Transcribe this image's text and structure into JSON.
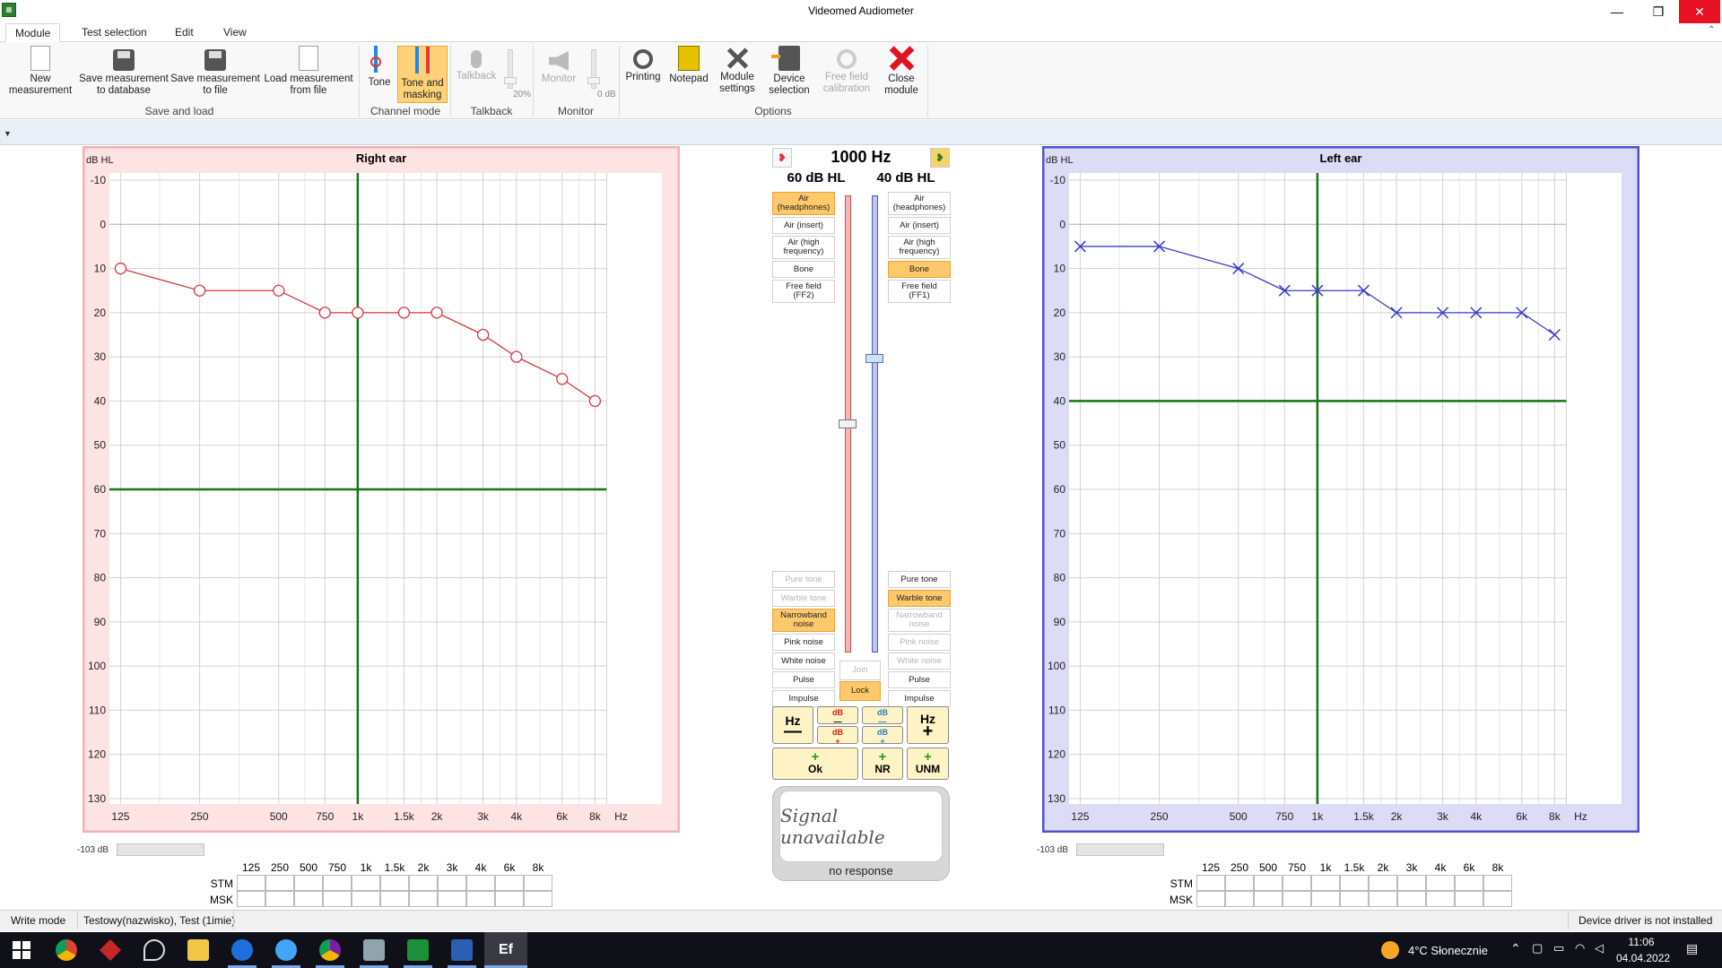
{
  "window": {
    "title": "Videomed Audiometer"
  },
  "ribbon": {
    "tabs": [
      "Module",
      "Test selection",
      "Edit",
      "View"
    ],
    "active_tab": "Module",
    "buttons": {
      "new_measurement": "New\nmeasurement",
      "save_db": "Save measurement\nto database",
      "save_file": "Save measurement\nto file",
      "load_file": "Load measurement\nfrom file",
      "tone": "Tone",
      "tone_masking": "Tone and\nmasking",
      "talkback": "Talkback",
      "monitor": "Monitor",
      "printing": "Printing",
      "notepad": "Notepad",
      "module_settings": "Module\nsettings",
      "device_selection": "Device\nselection",
      "free_field": "Free field\ncalibration",
      "close_module": "Close\nmodule"
    },
    "talkback_level": "20%",
    "monitor_level": "0 dB",
    "groups": {
      "save_load": "Save and load",
      "channel_mode": "Channel mode",
      "talkback": "Talkback",
      "monitor": "Monitor",
      "options": "Options"
    }
  },
  "charts": {
    "y_unit": "dB HL",
    "x_unit": "Hz",
    "y_ticks": [
      "-10",
      "0",
      "10",
      "20",
      "30",
      "40",
      "50",
      "60",
      "70",
      "80",
      "90",
      "100",
      "110",
      "120",
      "130"
    ],
    "x_ticks": [
      "125",
      "250",
      "500",
      "750",
      "1k",
      "1.5k",
      "2k",
      "3k",
      "4k",
      "6k",
      "8k"
    ]
  },
  "chart_data": [
    {
      "type": "line",
      "title": "Right ear",
      "xlabel": "Hz",
      "ylabel": "dB HL",
      "x": [
        "125",
        "250",
        "500",
        "750",
        "1k",
        "1.5k",
        "2k",
        "3k",
        "4k",
        "6k",
        "8k"
      ],
      "series": [
        {
          "values": [
            10,
            15,
            15,
            20,
            20,
            20,
            20,
            25,
            30,
            35,
            40
          ],
          "color": "#d9363e",
          "marker": "circle"
        }
      ],
      "ylim": [
        -10,
        130
      ],
      "y_inverted": true,
      "crosshair": {
        "x": "1k",
        "y": 60
      },
      "grid": true
    },
    {
      "type": "line",
      "title": "Left ear",
      "xlabel": "Hz",
      "ylabel": "dB HL",
      "x": [
        "125",
        "250",
        "500",
        "750",
        "1k",
        "1.5k",
        "2k",
        "3k",
        "4k",
        "6k",
        "8k"
      ],
      "series": [
        {
          "values": [
            5,
            5,
            10,
            15,
            15,
            15,
            20,
            20,
            20,
            20,
            25
          ],
          "color": "#3a3acc",
          "marker": "cross"
        }
      ],
      "ylim": [
        -10,
        130
      ],
      "y_inverted": true,
      "crosshair": {
        "x": "1k",
        "y": 40
      },
      "grid": true
    }
  ],
  "center": {
    "frequency": "1000 Hz",
    "right_level": "60 dB HL",
    "left_level": "40 dB HL",
    "right_slider_level_db": 60,
    "left_slider_level_db": 40,
    "right_transducers": [
      {
        "label": "Air (headphones)",
        "state": "selected"
      },
      {
        "label": "Air (insert)",
        "state": "normal"
      },
      {
        "label": "Air (high frequency)",
        "state": "normal"
      },
      {
        "label": "Bone",
        "state": "normal"
      },
      {
        "label": "Free field (FF2)",
        "state": "normal"
      }
    ],
    "left_transducers": [
      {
        "label": "Air (headphones)",
        "state": "normal"
      },
      {
        "label": "Air (insert)",
        "state": "normal"
      },
      {
        "label": "Air (high frequency)",
        "state": "normal"
      },
      {
        "label": "Bone",
        "state": "selected"
      },
      {
        "label": "Free field (FF1)",
        "state": "normal"
      }
    ],
    "right_signals": [
      {
        "label": "Pure tone",
        "state": "disabled"
      },
      {
        "label": "Warble tone",
        "state": "disabled"
      },
      {
        "label": "Narrowband noise",
        "state": "selected"
      },
      {
        "label": "Pink noise",
        "state": "normal"
      },
      {
        "label": "White noise",
        "state": "normal"
      },
      {
        "label": "Pulse",
        "state": "normal"
      },
      {
        "label": "Impulse",
        "state": "normal"
      }
    ],
    "left_signals": [
      {
        "label": "Pure tone",
        "state": "normal"
      },
      {
        "label": "Warble tone",
        "state": "selected"
      },
      {
        "label": "Narrowband noise",
        "state": "disabled"
      },
      {
        "label": "Pink noise",
        "state": "disabled"
      },
      {
        "label": "White noise",
        "state": "disabled"
      },
      {
        "label": "Pulse",
        "state": "normal"
      },
      {
        "label": "Impulse",
        "state": "normal"
      }
    ],
    "join_label": "Join",
    "lock_label": "Lock",
    "hz_label": "Hz",
    "db_label": "dB",
    "ok_label": "Ok",
    "nr_label": "NR",
    "unm_label": "UNM",
    "signal_status": "Signal unavailable",
    "response_status": "no response"
  },
  "tables": {
    "level_readout": "-103 dB",
    "headers": [
      "125",
      "250",
      "500",
      "750",
      "1k",
      "1.5k",
      "2k",
      "3k",
      "4k",
      "6k",
      "8k"
    ],
    "row_labels": [
      "STM",
      "MSK"
    ]
  },
  "status": {
    "mode": "Write mode",
    "patient": "Testowy(nazwisko), Test (1imie)",
    "driver": "Device driver is not installed"
  },
  "taskbar": {
    "weather": "4°C  Słonecznie",
    "time": "11:06",
    "date": "04.04.2022"
  },
  "colors": {
    "right_ear": "#d9363e",
    "left_ear": "#3a3acc",
    "crosshair": "#117711",
    "selected": "#ffc86a"
  }
}
